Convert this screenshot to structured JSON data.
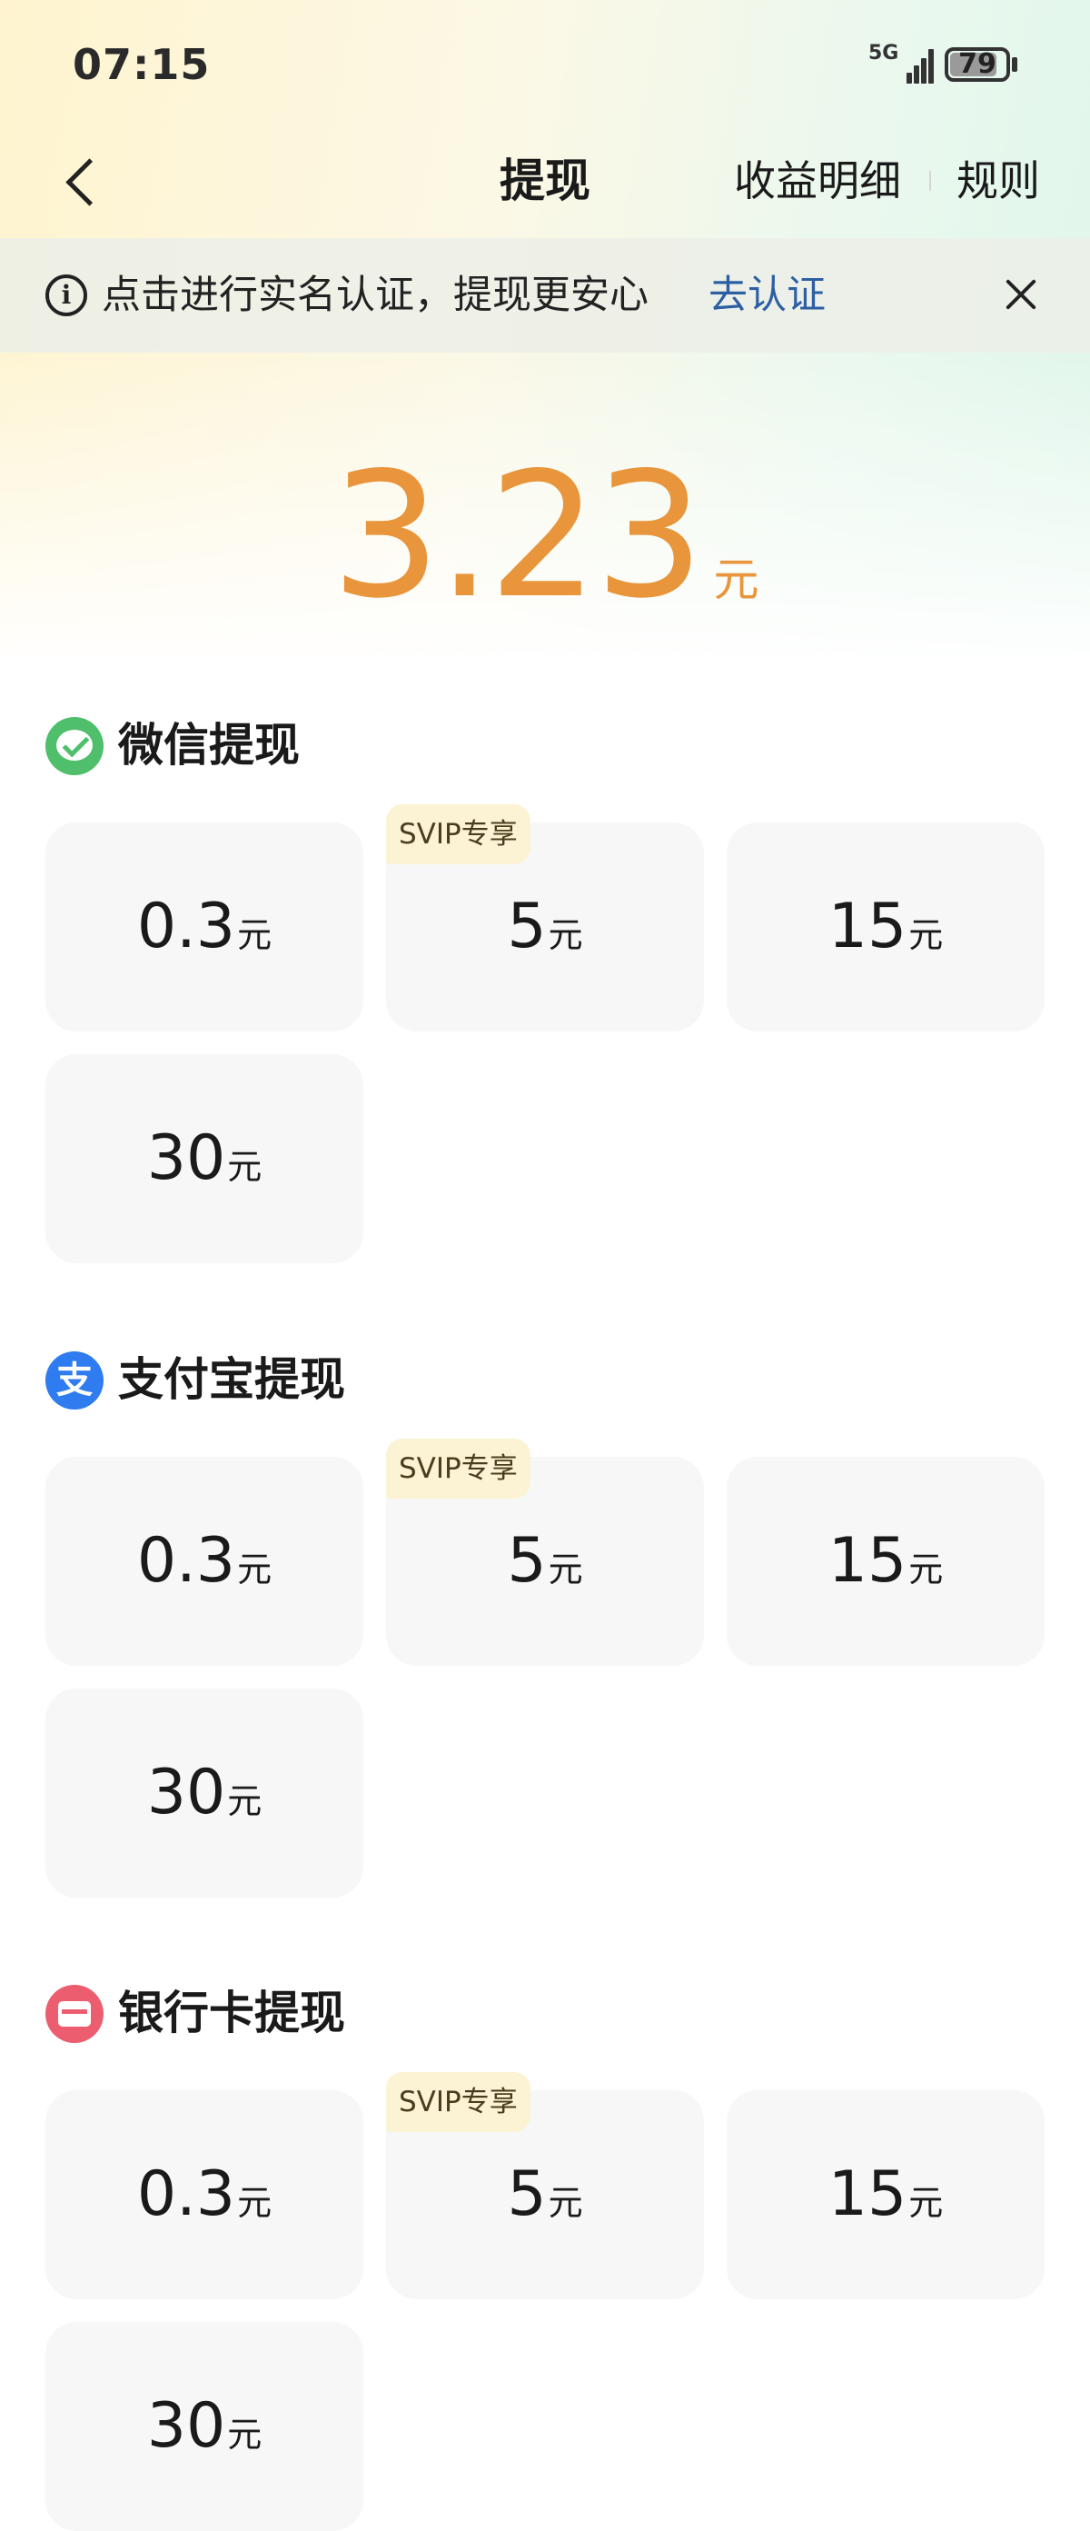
{
  "status_bar": {
    "time": "07:15",
    "network": "5G",
    "battery": "79",
    "battery_fraction": 0.79
  },
  "nav": {
    "title": "提现",
    "earnings_detail": "收益明细",
    "rules": "规则"
  },
  "notice": {
    "text": "点击进行实名认证，提现更安心",
    "action": "去认证"
  },
  "balance": {
    "amount": "3.23",
    "unit": "元"
  },
  "sections": [
    {
      "title": "微信提现",
      "icon": "wechat-icon",
      "options": [
        {
          "value": "0.3",
          "unit": "元"
        },
        {
          "value": "5",
          "unit": "元",
          "badge": "SVIP专享"
        },
        {
          "value": "15",
          "unit": "元"
        },
        {
          "value": "30",
          "unit": "元"
        }
      ]
    },
    {
      "title": "支付宝提现",
      "icon": "alipay-icon",
      "icon_glyph": "支",
      "options": [
        {
          "value": "0.3",
          "unit": "元"
        },
        {
          "value": "5",
          "unit": "元",
          "badge": "SVIP专享"
        },
        {
          "value": "15",
          "unit": "元"
        },
        {
          "value": "30",
          "unit": "元"
        }
      ]
    },
    {
      "title": "银行卡提现",
      "icon": "bank-card-icon",
      "options": [
        {
          "value": "0.3",
          "unit": "元"
        },
        {
          "value": "5",
          "unit": "元",
          "badge": "SVIP专享"
        },
        {
          "value": "15",
          "unit": "元"
        },
        {
          "value": "30",
          "unit": "元"
        }
      ]
    }
  ],
  "colors": {
    "accent": "#e8953b",
    "link": "#2d5fa3",
    "wechat": "#4fbf6b",
    "alipay": "#2f7cf0",
    "bank": "#ec5e6f"
  }
}
